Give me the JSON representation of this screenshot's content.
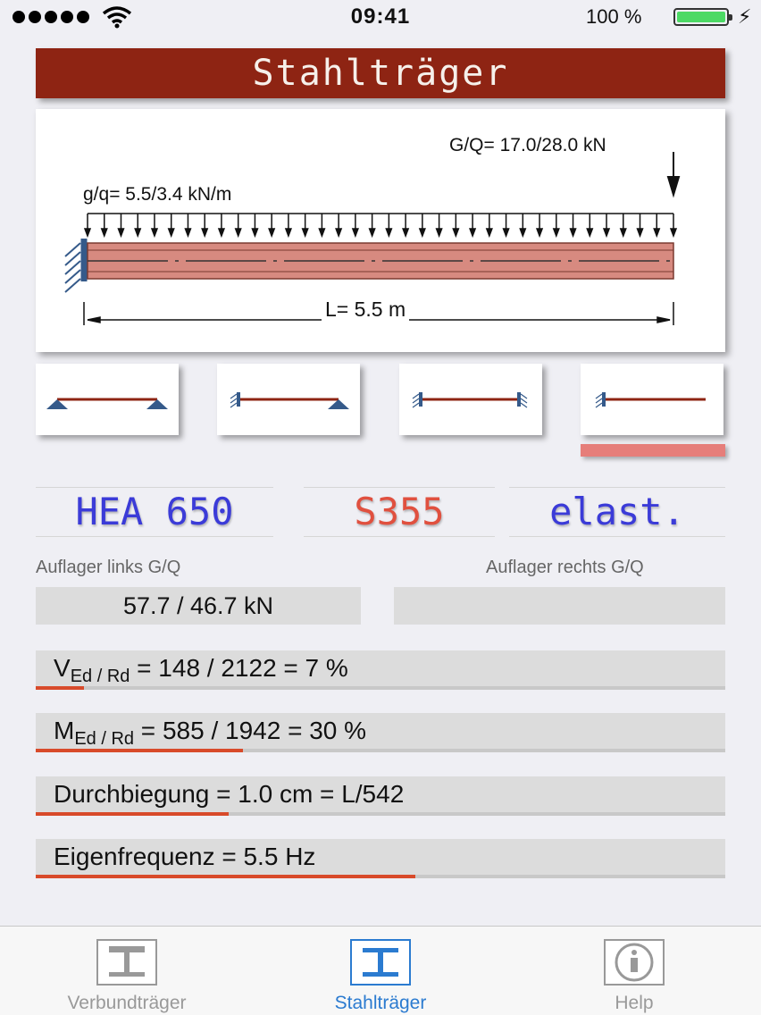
{
  "status_bar": {
    "time": "09:41",
    "battery": "100 %"
  },
  "title": "Stahlträger",
  "beam": {
    "point_load_label": "G/Q= 17.0/28.0 kN",
    "line_load_label": "g/q= 5.5/3.4 kN/m",
    "span_label": "L= 5.5 m"
  },
  "support_options": [
    "pinned-pinned",
    "fixed-pinned",
    "fixed-fixed",
    "cantilever"
  ],
  "selected_support": "cantilever",
  "section": {
    "profile": "HEA 650",
    "steel": "S355",
    "method": "elast."
  },
  "colors": {
    "title_bg": "#8e2413",
    "profile_text": "#3b3bd8",
    "steel_text": "#e0503f",
    "beam_fill": "#d78a80",
    "utilization_bar": "#d84a2a",
    "tab_active": "#2b7bd0"
  },
  "reactions": {
    "left_label": "Auflager links  G/Q",
    "right_label": "Auflager rechts  G/Q",
    "left_value": "57.7 / 46.7 kN",
    "right_value": ""
  },
  "results": {
    "shear": {
      "symbol": "V",
      "sub": "Ed / Rd",
      "text": " = 148 / 2122 = 7 %",
      "ratio": 0.07
    },
    "moment": {
      "symbol": "M",
      "sub": "Ed / Rd",
      "text": " = 585 / 1942 = 30 %",
      "ratio": 0.3
    },
    "deflection": {
      "text": "Durchbiegung = 1.0 cm = L/542",
      "ratio": 0.28
    },
    "frequency": {
      "text": "Eigenfrequenz = 5.5 Hz",
      "ratio": 0.55
    }
  },
  "tabs": [
    {
      "label": "Verbundträger",
      "icon": "composite-beam-icon",
      "active": false
    },
    {
      "label": "Stahlträger",
      "icon": "steel-beam-icon",
      "active": true
    },
    {
      "label": "Help",
      "icon": "info-icon",
      "active": false
    }
  ]
}
